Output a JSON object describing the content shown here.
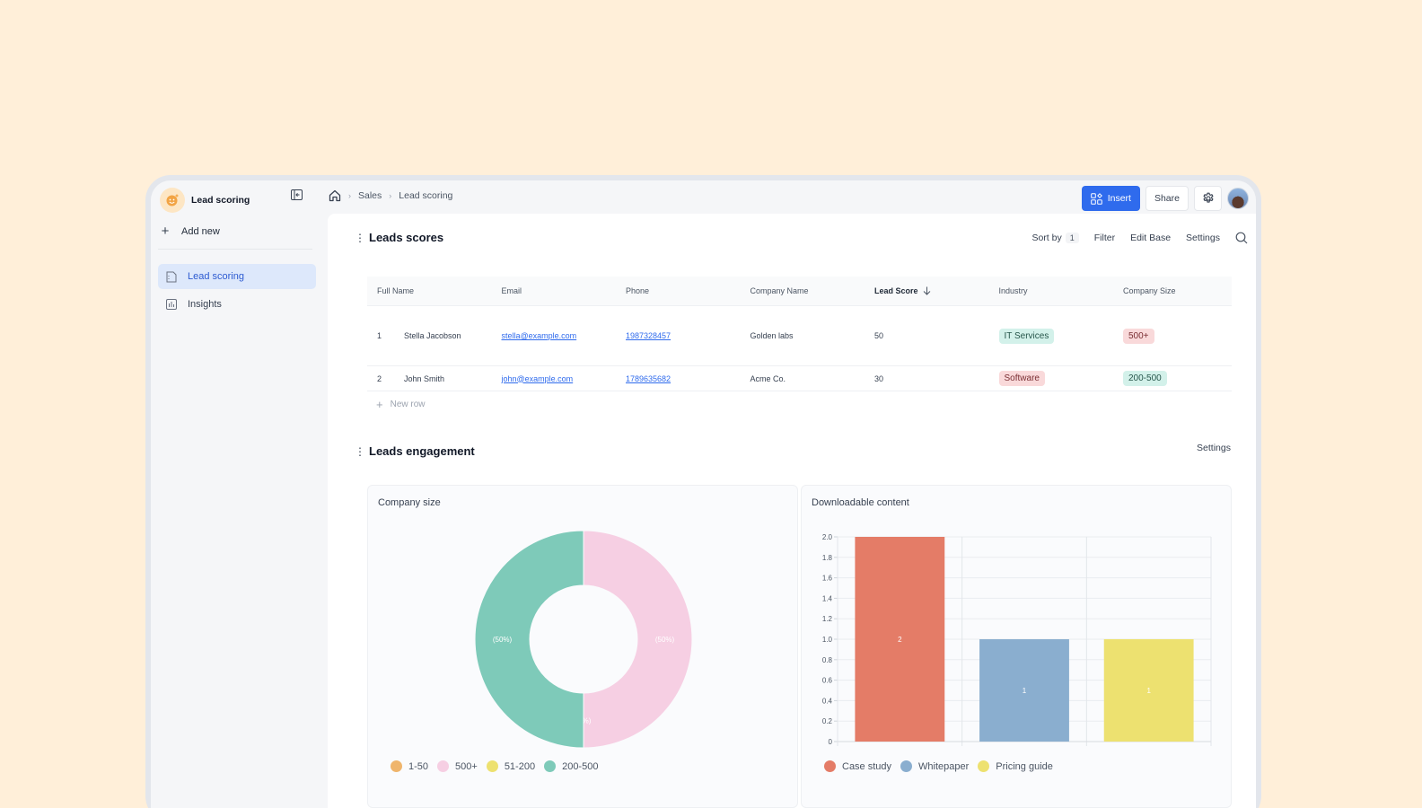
{
  "app": {
    "title": "Lead scoring"
  },
  "sidebar": {
    "add_new": "Add new",
    "items": [
      {
        "label": "Lead scoring",
        "icon": "document-icon",
        "active": true
      },
      {
        "label": "Insights",
        "icon": "chart-icon",
        "active": false
      }
    ]
  },
  "breadcrumb": {
    "items": [
      "Sales",
      "Lead scoring"
    ]
  },
  "topbar": {
    "insert": "Insert",
    "share": "Share"
  },
  "leads_scores": {
    "title": "Leads scores",
    "toolbar": {
      "sort_by": "Sort by",
      "sort_count": "1",
      "filter": "Filter",
      "edit_base": "Edit Base",
      "settings": "Settings"
    },
    "columns": [
      "Full Name",
      "Email",
      "Phone",
      "Company Name",
      "Lead Score",
      "Industry",
      "Company Size"
    ],
    "rows": [
      {
        "index": "1",
        "name": "Stella Jacobson",
        "email": "stella@example.com",
        "phone": "1987328457",
        "company": "Golden labs",
        "score": "50",
        "industry": "IT Services",
        "industry_color": "green",
        "size": "500+",
        "size_color": "red"
      },
      {
        "index": "2",
        "name": "John Smith",
        "email": "john@example.com",
        "phone": "1789635682",
        "company": "Acme Co.",
        "score": "30",
        "industry": "Software",
        "industry_color": "red",
        "size": "200-500",
        "size_color": "green"
      }
    ],
    "new_row": "New row"
  },
  "leads_engagement": {
    "title": "Leads engagement",
    "settings": "Settings"
  },
  "chart_data": [
    {
      "type": "pie",
      "title": "Company size",
      "donut": true,
      "slices": [
        {
          "label": "1-50",
          "value": 0,
          "percent_label": "(0%)",
          "color": "#efb56c"
        },
        {
          "label": "500+",
          "value": 1,
          "percent_label": "(50%)",
          "color": "#f6cfe3"
        },
        {
          "label": "51-200",
          "value": 0,
          "percent_label": "(0%)",
          "color": "#ede170"
        },
        {
          "label": "200-500",
          "value": 1,
          "percent_label": "(50%)",
          "color": "#7ecab9"
        }
      ],
      "legend": "bottom-left"
    },
    {
      "type": "bar",
      "title": "Downloadable content",
      "categories": [
        "Case study",
        "Whitepaper",
        "Pricing guide"
      ],
      "values": [
        2,
        1,
        1
      ],
      "colors": [
        "#e47c67",
        "#8aaecf",
        "#ede170"
      ],
      "yticks": [
        "0",
        "0.2",
        "0.4",
        "0.6",
        "0.8",
        "1.0",
        "1.2",
        "1.4",
        "1.6",
        "1.8",
        "2.0"
      ],
      "ylim": [
        0,
        2
      ],
      "grid": true,
      "legend": "bottom-left"
    }
  ]
}
